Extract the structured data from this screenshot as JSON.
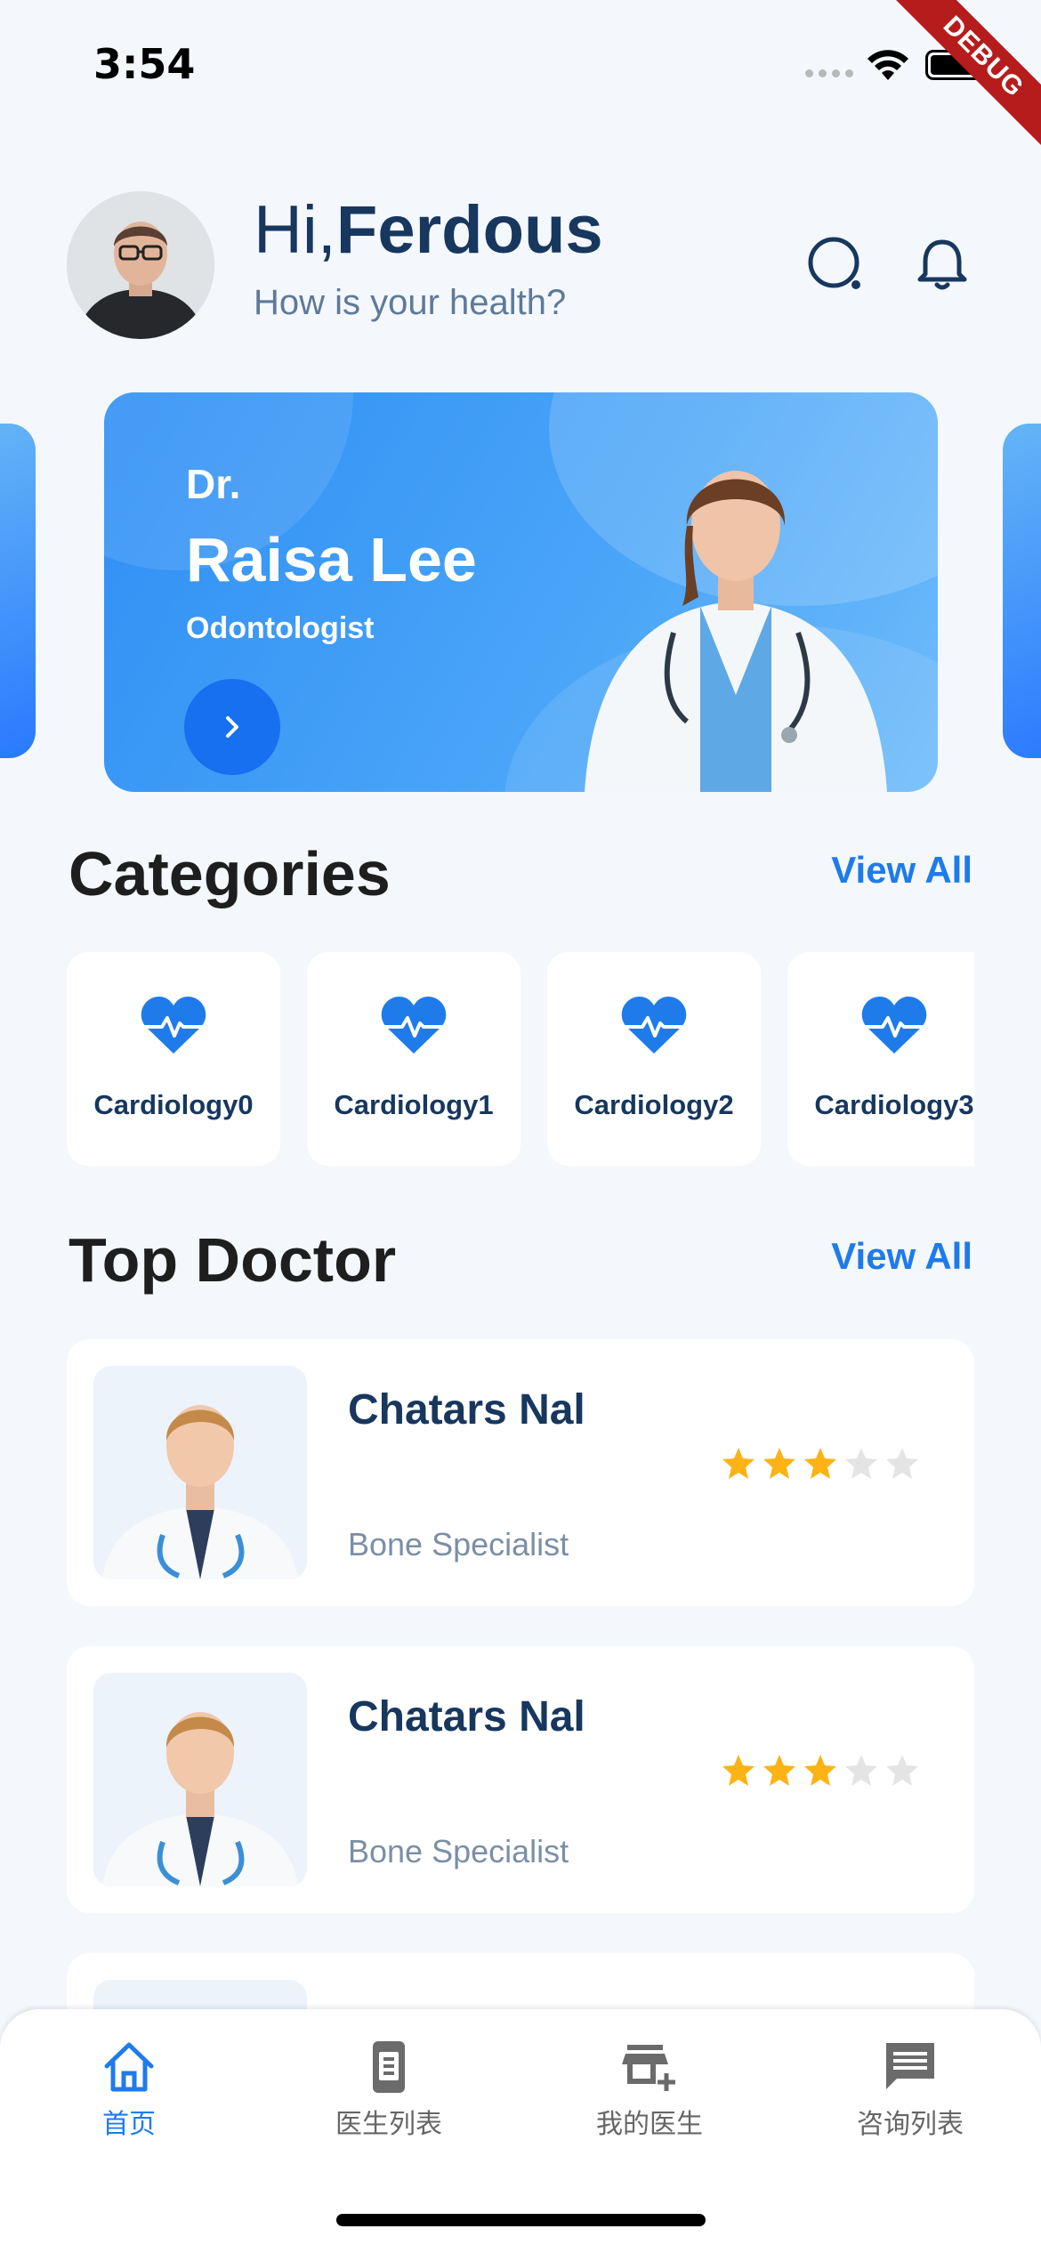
{
  "status_bar": {
    "time": "3:54",
    "debug_label": "DEBUG"
  },
  "header": {
    "greeting_prefix": "Hi,",
    "user_name": "Ferdous",
    "subtitle": "How is your health?"
  },
  "banner": {
    "title_prefix": "Dr.",
    "doctor_name": "Raisa Lee",
    "specialty": "Odontologist"
  },
  "categories": {
    "title": "Categories",
    "view_all": "View All",
    "items": [
      {
        "label": "Cardiology0",
        "icon": "heart-pulse-icon"
      },
      {
        "label": "Cardiology1",
        "icon": "heart-pulse-icon"
      },
      {
        "label": "Cardiology2",
        "icon": "heart-pulse-icon"
      },
      {
        "label": "Cardiology3",
        "icon": "heart-pulse-icon"
      }
    ]
  },
  "top_doctor": {
    "title": "Top Doctor",
    "view_all": "View All",
    "doctors": [
      {
        "name": "Chatars Nal",
        "specialty": "Bone Specialist",
        "rating": 3,
        "max_rating": 5
      },
      {
        "name": "Chatars Nal",
        "specialty": "Bone Specialist",
        "rating": 3,
        "max_rating": 5
      }
    ]
  },
  "bottom_nav": {
    "items": [
      {
        "label": "首页",
        "icon": "home-icon",
        "active": true
      },
      {
        "label": "医生列表",
        "icon": "phone-icon",
        "active": false
      },
      {
        "label": "我的医生",
        "icon": "add-business-icon",
        "active": false
      },
      {
        "label": "咨询列表",
        "icon": "chat-icon",
        "active": false
      }
    ]
  },
  "colors": {
    "accent": "#1F7BEA",
    "navy": "#17375E",
    "background": "#F4F8FD",
    "star_filled": "#FDB316",
    "star_empty": "#E4E4E4"
  }
}
